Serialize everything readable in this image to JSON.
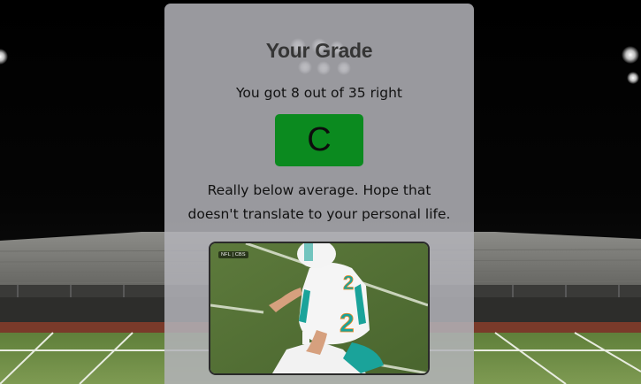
{
  "result": {
    "title": "Your Grade",
    "score_text": "You got 8 out of 35 right",
    "grade": "C",
    "comment": "Really below average. Hope that doesn't translate to your personal life."
  },
  "media": {
    "watermark": "NFL | CBS",
    "jersey_number": "2",
    "subject": "football player kneeling on field"
  },
  "colors": {
    "grade_badge": "#0b8a1f",
    "card_background": "#b2b2b8",
    "title_text": "#353535"
  }
}
